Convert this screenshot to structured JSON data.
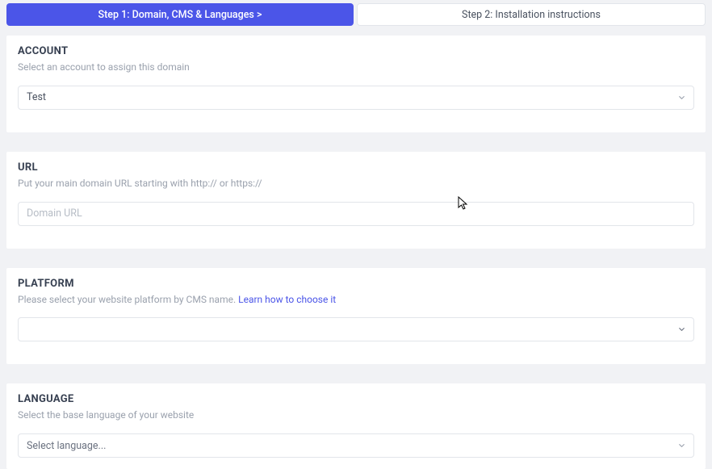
{
  "tabs": {
    "step1": "Step 1: Domain, CMS & Languages  >",
    "step2": "Step 2: Installation instructions"
  },
  "account": {
    "title": "ACCOUNT",
    "desc": "Select an account to assign this domain",
    "value": "Test"
  },
  "url": {
    "title": "URL",
    "desc": "Put your main domain URL starting with http:// or https://",
    "placeholder": "Domain URL"
  },
  "platform": {
    "title": "PLATFORM",
    "desc_prefix": "Please select your website platform by CMS name. ",
    "link": "Learn how to choose it",
    "value": ""
  },
  "language": {
    "title": "LANGUAGE",
    "desc": "Select the base language of your website",
    "value": "Select language..."
  }
}
